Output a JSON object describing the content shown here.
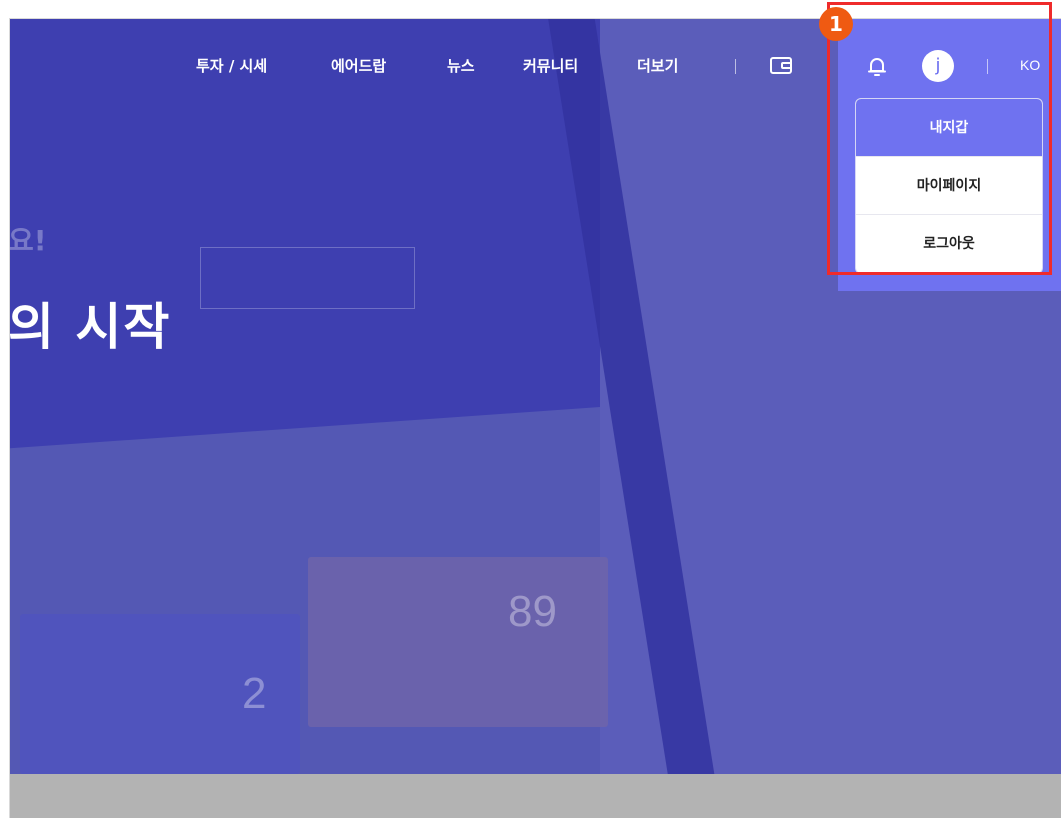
{
  "nav": {
    "items": [
      "투자 / 시세",
      "에어드랍",
      "뉴스",
      "커뮤니티",
      "더보기"
    ]
  },
  "header": {
    "avatar_initial": "j",
    "language": "KO",
    "icons": [
      "wallet-icon",
      "bell-icon"
    ]
  },
  "dropdown": {
    "items": [
      "내지갑",
      "마이페이지",
      "로그아웃"
    ],
    "active_index": 0
  },
  "hero": {
    "tag": "요!",
    "headline": "의 시작",
    "card1_value": "2",
    "card2_value": "89"
  },
  "annotation": {
    "badge": "1",
    "color": "#ef2b2b",
    "badge_color": "#ef5a12"
  },
  "colors": {
    "accent": "#6f72f0",
    "hero_bg": "#5458b4"
  }
}
